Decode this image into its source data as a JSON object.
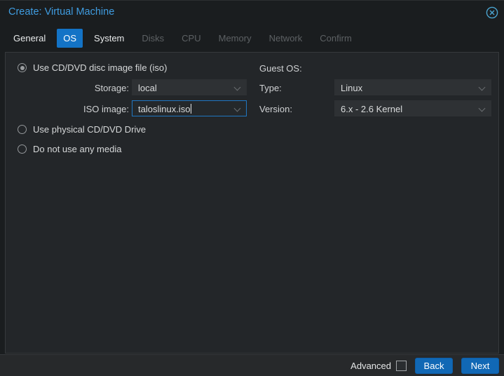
{
  "window": {
    "title": "Create: Virtual Machine"
  },
  "tabs": [
    {
      "label": "General",
      "state": "normal"
    },
    {
      "label": "OS",
      "state": "active"
    },
    {
      "label": "System",
      "state": "normal"
    },
    {
      "label": "Disks",
      "state": "disabled"
    },
    {
      "label": "CPU",
      "state": "disabled"
    },
    {
      "label": "Memory",
      "state": "disabled"
    },
    {
      "label": "Network",
      "state": "disabled"
    },
    {
      "label": "Confirm",
      "state": "disabled"
    }
  ],
  "os_panel": {
    "radios": [
      {
        "label": "Use CD/DVD disc image file (iso)",
        "state": "checked"
      },
      {
        "label": "Use physical CD/DVD Drive",
        "state": "unchecked"
      },
      {
        "label": "Do not use any media",
        "state": "unchecked"
      }
    ],
    "storage": {
      "label": "Storage:",
      "value": "local"
    },
    "iso_image": {
      "label": "ISO image:",
      "value": "taloslinux.iso",
      "focused": true
    },
    "guest_os": {
      "heading": "Guest OS:",
      "type": {
        "label": "Type:",
        "value": "Linux"
      },
      "version": {
        "label": "Version:",
        "value": "6.x - 2.6 Kernel"
      }
    }
  },
  "footer": {
    "advanced_label": "Advanced",
    "advanced_state": "unchecked",
    "back_label": "Back",
    "next_label": "Next"
  },
  "colors": {
    "accent_blue": "#1373c6",
    "button_blue": "#1168b5",
    "title_blue": "#3f9ce0",
    "focus_border": "#2077c2",
    "panel_bg": "#232629",
    "window_bg": "#1a1d1f"
  }
}
